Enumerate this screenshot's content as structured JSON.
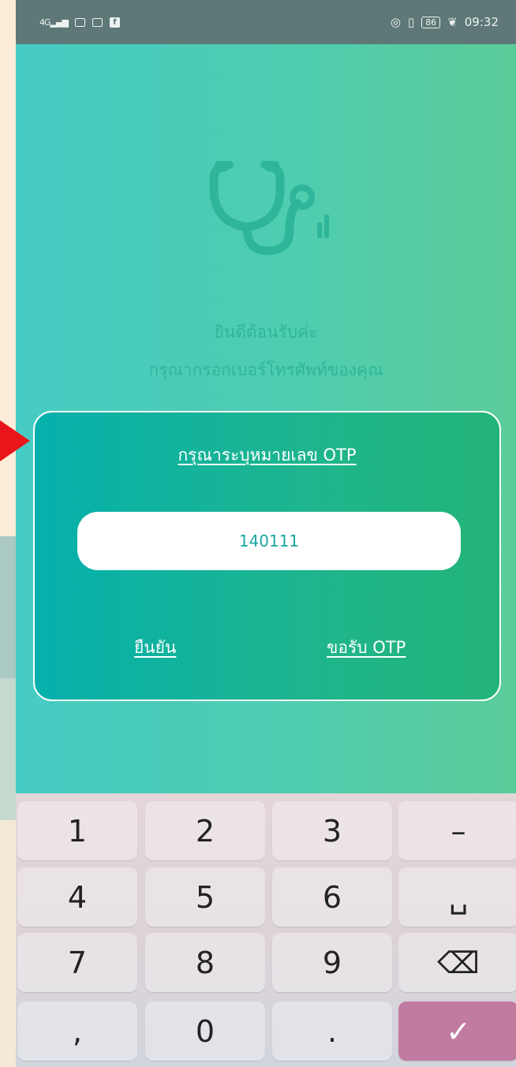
{
  "status_bar": {
    "network": "4G",
    "battery": "86",
    "time": "09:32"
  },
  "welcome": {
    "line1": "ยินดีต้อนรับค่ะ",
    "line2": "กรุณากรอกเบอร์โทรศัพท์ของคุณ"
  },
  "otp": {
    "title": "กรุณาระบุหมายเลข OTP",
    "value": "140111",
    "confirm_label": "ยืนยัน",
    "request_label": "ขอรับ OTP"
  },
  "keyboard": {
    "k1": "1",
    "k2": "2",
    "k3": "3",
    "minus": "–",
    "k4": "4",
    "k5": "5",
    "k6": "6",
    "space": "␣",
    "k7": "7",
    "k8": "8",
    "k9": "9",
    "backspace": "⌫",
    "comma": ",",
    "k0": "0",
    "period": ".",
    "enter": "✓"
  },
  "colors": {
    "accent": "#1fb58d",
    "enter_key": "#c17aa0",
    "logo": "#2fb59a"
  }
}
